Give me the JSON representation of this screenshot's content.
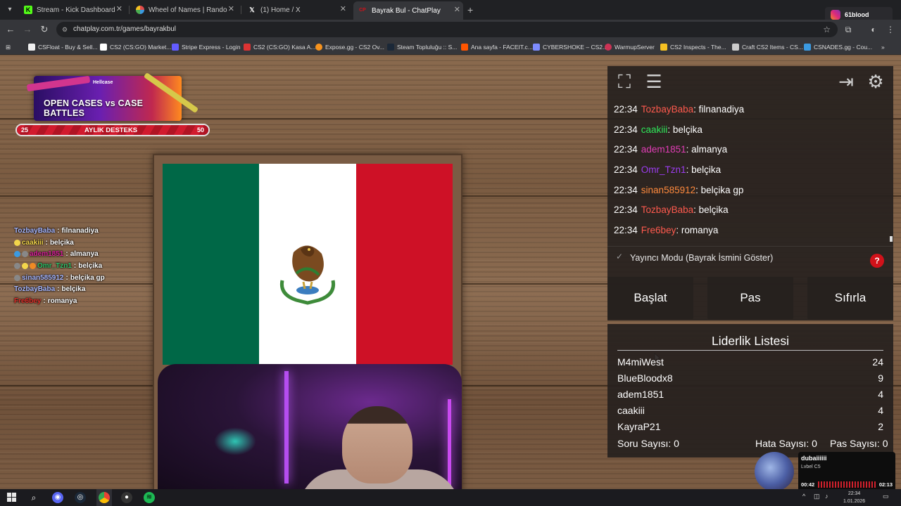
{
  "browser": {
    "tabs": [
      {
        "label": "Stream - Kick Dashboard",
        "icon": "kick-icon",
        "color": "#53fc18"
      },
      {
        "label": "Wheel of Names | Random nam",
        "icon": "wheel-icon",
        "color": "#e34b4b"
      },
      {
        "label": "(1) Home / X",
        "icon": "x-icon",
        "color": "#ffffff"
      },
      {
        "label": "Bayrak Bul - ChatPlay",
        "icon": "chatplay-icon",
        "color": "#d1121a"
      }
    ],
    "active_tab": 3,
    "url": "chatplay.com.tr/games/bayrakbul",
    "profile_name": "61blood",
    "bookmarks": [
      "CSFloat - Buy & Sell...",
      "CS2 (CS:GO) Market...",
      "Stripe Express - Login",
      "CS2 (CS:GO) Kasa A...",
      "Expose.gg - CS2 Ov...",
      "Steam Topluluğu :: S...",
      "Ana sayfa - FACEIT.c...",
      "CYBERSHOKE – CS2...",
      "WarmupServer",
      "CS2 Inspects - The...",
      "Craft CS2 Items - CS...",
      "CSNADES.gg - Cou..."
    ]
  },
  "promo": {
    "brand": "Hellcase",
    "text": "OPEN CASES vs CASE BATTLES"
  },
  "support_bar": {
    "label": "AYLIK DESTEKS",
    "min": "25",
    "max": "50",
    "fill_fraction": 0.0
  },
  "overlay_chat": [
    {
      "user": "TozbayBaba",
      "msg": "filnanadiya",
      "color": "#a9b8ff"
    },
    {
      "user": "caakiii",
      "msg": "belçika",
      "color": "#f2d54b"
    },
    {
      "user": "adem1851",
      "msg": "almanya",
      "color": "#d9209a"
    },
    {
      "user": "Omr_Tzn1",
      "msg": "belçika",
      "color": "#30c26a"
    },
    {
      "user": "sinan585912",
      "msg": "belçika gp",
      "color": "#a9b8ff"
    },
    {
      "user": "TozbayBaba",
      "msg": "belçika",
      "color": "#a9b8ff"
    },
    {
      "user": "Fre6bey",
      "msg": "romanya",
      "color": "#e0302a"
    }
  ],
  "flag": {
    "country_colors": [
      "#006847",
      "#ffffff",
      "#ce1126"
    ]
  },
  "chat": [
    {
      "time": "22:34",
      "user": "TozbayBaba",
      "msg": "filnanadiya",
      "color": "#ff5a4e"
    },
    {
      "time": "22:34",
      "user": "caakiii",
      "msg": "belçika",
      "color": "#2ee85a"
    },
    {
      "time": "22:34",
      "user": "adem1851",
      "msg": "almanya",
      "color": "#e03db5"
    },
    {
      "time": "22:34",
      "user": "Omr_Tzn1",
      "msg": "belçika",
      "color": "#9b3cf0"
    },
    {
      "time": "22:34",
      "user": "sinan585912",
      "msg": "belçika gp",
      "color": "#ff8a3d"
    },
    {
      "time": "22:34",
      "user": "TozbayBaba",
      "msg": "belçika",
      "color": "#ff5a4e"
    },
    {
      "time": "22:34",
      "user": "Fre6bey",
      "msg": "romanya",
      "color": "#ff5a4e"
    }
  ],
  "streamer_mode": "Yayıncı Modu (Bayrak İsmini Göster)",
  "help_label": "?",
  "buttons": {
    "start": "Başlat",
    "pass": "Pas",
    "reset": "Sıfırla"
  },
  "leaderboard": {
    "title": "Liderlik Listesi",
    "rows": [
      {
        "name": "M4miWest",
        "score": "24"
      },
      {
        "name": "BlueBloodx8",
        "score": "9"
      },
      {
        "name": "adem1851",
        "score": "4"
      },
      {
        "name": "caakiii",
        "score": "4"
      },
      {
        "name": "KayraP21",
        "score": "2"
      }
    ],
    "questions": "Soru Sayısı: 0",
    "errors": "Hata Sayısı: 0",
    "passes": "Pas Sayısı: 0"
  },
  "music": {
    "track": "dubaiiiiii",
    "artist": "Lvbel C5",
    "elapsed": "00:42",
    "duration": "02:13"
  },
  "taskbar": {
    "time": "22:34",
    "date": "1.01.2026"
  }
}
